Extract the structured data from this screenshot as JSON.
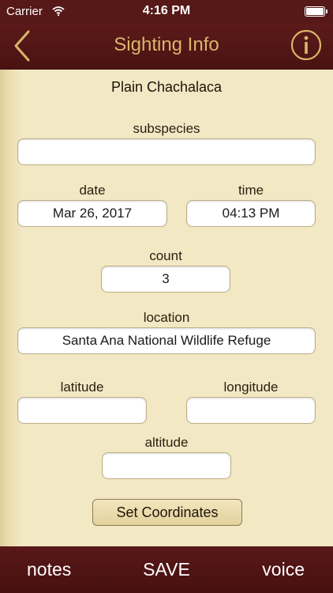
{
  "status_bar": {
    "carrier": "Carrier",
    "time": "4:16 PM"
  },
  "nav": {
    "title": "Sighting Info",
    "back_icon": "chevron-left-icon",
    "info_icon": "info-circle-icon"
  },
  "species": "Plain Chachalaca",
  "form": {
    "subspecies_label": "subspecies",
    "subspecies_value": "",
    "date_label": "date",
    "date_value": "Mar 26, 2017",
    "time_label": "time",
    "time_value": "04:13 PM",
    "count_label": "count",
    "count_value": "3",
    "location_label": "location",
    "location_value": "Santa Ana National Wildlife Refuge",
    "latitude_label": "latitude",
    "latitude_value": "",
    "longitude_label": "longitude",
    "longitude_value": "",
    "altitude_label": "altitude",
    "altitude_value": "",
    "set_coordinates_label": "Set Coordinates"
  },
  "toolbar": {
    "notes_label": "notes",
    "save_label": "SAVE",
    "voice_label": "voice"
  },
  "colors": {
    "bar_background": "#571818",
    "title_gold": "#d9b66a",
    "content_background": "#f2e8c4"
  }
}
